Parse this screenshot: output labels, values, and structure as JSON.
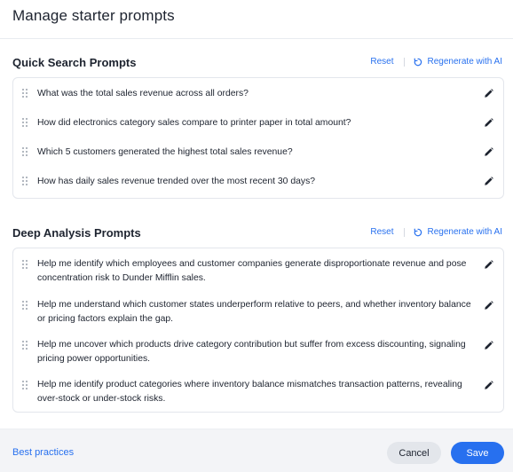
{
  "dialog": {
    "title": "Manage starter prompts"
  },
  "quick_section": {
    "title": "Quick Search Prompts",
    "reset_label": "Reset",
    "regenerate_label": "Regenerate with AI",
    "prompts": [
      "What was the total sales revenue across all orders?",
      "How did electronics category sales compare to printer paper in total amount?",
      "Which 5 customers generated the highest total sales revenue?",
      "How has daily sales revenue trended over the most recent 30 days?"
    ]
  },
  "deep_section": {
    "title": "Deep Analysis Prompts",
    "reset_label": "Reset",
    "regenerate_label": "Regenerate with AI",
    "prompts": [
      "Help me identify which employees and customer companies generate disproportionate revenue and pose concentration risk to Dunder Mifflin sales.",
      "Help me understand which customer states underperform relative to peers, and whether inventory balance or pricing factors explain the gap.",
      "Help me uncover which products drive category contribution but suffer from excess discounting, signaling pricing power opportunities.",
      "Help me identify product categories where inventory balance mismatches transaction patterns, revealing over-stock or under-stock risks."
    ]
  },
  "footer": {
    "best_practices_label": "Best practices",
    "cancel_label": "Cancel",
    "save_label": "Save"
  },
  "icons": {
    "drag_handle": "drag-handle-icon",
    "edit": "pencil-icon",
    "regenerate": "refresh-icon"
  },
  "colors": {
    "accent": "#2770ef",
    "text": "#1d232f",
    "footer_bg": "#f3f4f7"
  }
}
